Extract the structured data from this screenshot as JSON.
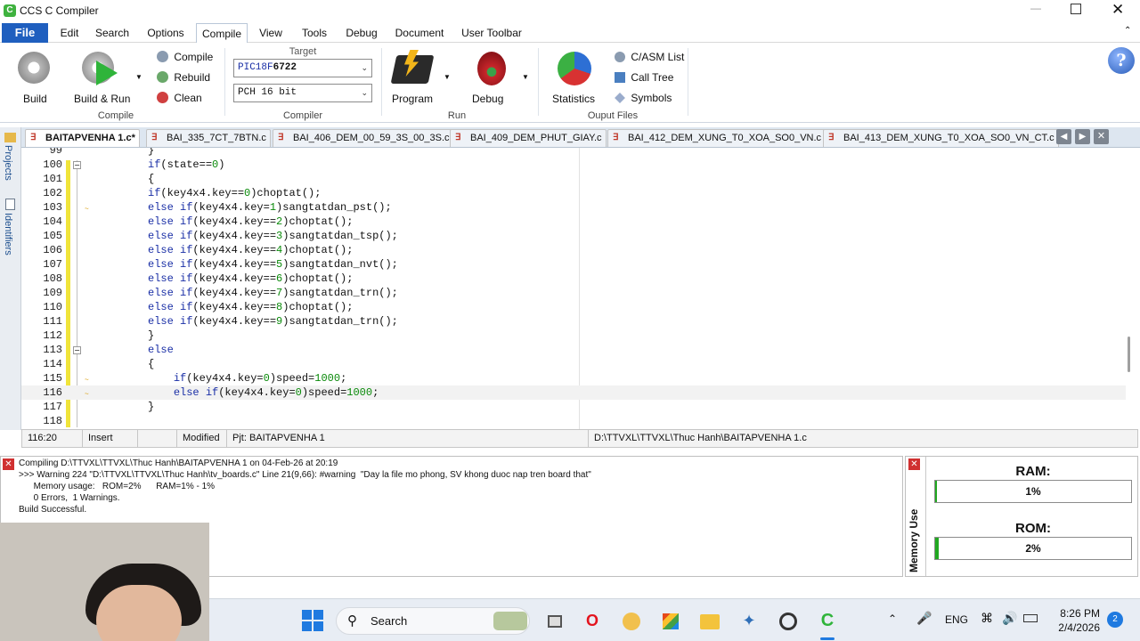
{
  "app": {
    "title": "CCS C Compiler"
  },
  "menu": [
    "File",
    "Edit",
    "Search",
    "Options",
    "Compile",
    "View",
    "Tools",
    "Debug",
    "Document",
    "User Toolbar"
  ],
  "ribbon": {
    "compile_group": {
      "label": "Compile",
      "build": "Build",
      "build_run": "Build & Run",
      "compile": "Compile",
      "rebuild": "Rebuild",
      "clean": "Clean"
    },
    "compiler_group": {
      "label": "Compiler",
      "target_label": "Target",
      "target_prefix": "PIC18F",
      "target_suffix": "6722",
      "pch": "PCH 16 bit"
    },
    "run_group": {
      "label": "Run",
      "program": "Program",
      "debug": "Debug"
    },
    "output_group": {
      "label": "Ouput Files",
      "statistics": "Statistics",
      "casm": "C/ASM List",
      "calltree": "Call Tree",
      "symbols": "Symbols"
    }
  },
  "tabs": [
    "BAITAPVENHA 1.c*",
    "BAI_335_7CT_7BTN.c",
    "BAI_406_DEM_00_59_3S_00_3S.c",
    "BAI_409_DEM_PHUT_GIAY.c",
    "BAI_412_DEM_XUNG_T0_XOA_SO0_VN.c",
    "BAI_413_DEM_XUNG_T0_XOA_SO0_VN_CT.c"
  ],
  "sidebar": {
    "projects": "Projects",
    "identifiers": "Identifiers"
  },
  "editor": {
    "lines": [
      {
        "n": "99",
        "t": "}"
      },
      {
        "n": "100",
        "t": "if(state==0)"
      },
      {
        "n": "101",
        "t": "{"
      },
      {
        "n": "102",
        "t": "if(key4x4.key==0)choptat();"
      },
      {
        "n": "103",
        "t": "else if(key4x4.key=1)sangtatdan_pst();"
      },
      {
        "n": "104",
        "t": "else if(key4x4.key==2)choptat();"
      },
      {
        "n": "105",
        "t": "else if(key4x4.key==3)sangtatdan_tsp();"
      },
      {
        "n": "106",
        "t": "else if(key4x4.key==4)choptat();"
      },
      {
        "n": "107",
        "t": "else if(key4x4.key==5)sangtatdan_nvt();"
      },
      {
        "n": "108",
        "t": "else if(key4x4.key==6)choptat();"
      },
      {
        "n": "109",
        "t": "else if(key4x4.key==7)sangtatdan_trn();"
      },
      {
        "n": "110",
        "t": "else if(key4x4.key==8)choptat();"
      },
      {
        "n": "111",
        "t": "else if(key4x4.key==9)sangtatdan_trn();"
      },
      {
        "n": "112",
        "t": "}"
      },
      {
        "n": "113",
        "t": "else"
      },
      {
        "n": "114",
        "t": "{"
      },
      {
        "n": "115",
        "t": "    if(key4x4.key=0)speed=1000;"
      },
      {
        "n": "116",
        "t": "    else if(key4x4.key=0)speed=1000;"
      },
      {
        "n": "117",
        "t": "}"
      },
      {
        "n": "118",
        "t": ""
      }
    ]
  },
  "status": {
    "pos": "116:20",
    "mode": "Insert",
    "modified": "Modified",
    "project": "Pjt: BAITAPVENHA 1",
    "path": "D:\\TTVXL\\TTVXL\\Thuc Hanh\\BAITAPVENHA 1.c"
  },
  "output": {
    "lines": [
      "Compiling D:\\TTVXL\\TTVXL\\Thuc Hanh\\BAITAPVENHA 1 on 04-Feb-26 at 20:19",
      ">>> Warning 224 \"D:\\TTVXL\\TTVXL\\Thuc Hanh\\tv_boards.c\" Line 21(9,66): #warning  \"Day la file mo phong, SV khong duoc nap tren board that\"",
      "      Memory usage:   ROM=2%      RAM=1% - 1%",
      "      0 Errors,  1 Warnings.",
      "Build Successful."
    ]
  },
  "memory": {
    "title": "Memory Use",
    "ram_label": "RAM:",
    "ram_value": "1%",
    "ram_fraction": 0.01,
    "rom_label": "ROM:",
    "rom_value": "2%",
    "rom_fraction": 0.02
  },
  "taskbar": {
    "search": "Search",
    "lang": "ENG",
    "time": "8:26 PM",
    "date": "2/4/2026",
    "notif_count": "2"
  },
  "colors": {
    "file_menu": "#1f5fbf",
    "keyword": "#1a2fa6",
    "number": "#0a8a0a",
    "progress": "#21a821"
  }
}
